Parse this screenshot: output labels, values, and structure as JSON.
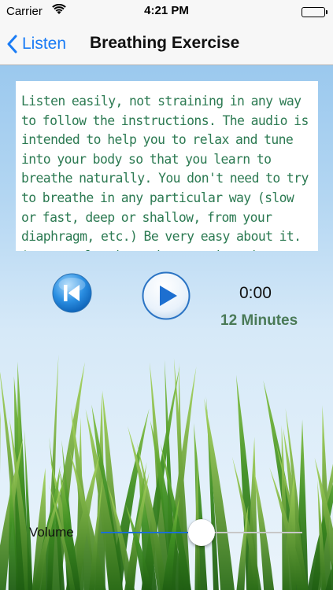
{
  "status_bar": {
    "carrier": "Carrier",
    "time": "4:21 PM"
  },
  "nav": {
    "back_label": "Listen",
    "title": "Breathing Exercise"
  },
  "instructions": {
    "text": "Listen easily, not straining in any way to follow the instructions. The audio is intended to help you to relax and tune into your body so that you learn to breathe naturally. You don't need to try to breathe in any particular way (slow or fast, deep or shallow, from your diaphragm, etc.) Be very easy about it. As you relax into the exercise, it"
  },
  "player": {
    "elapsed": "0:00",
    "duration": "12 Minutes",
    "rewind_icon": "rewind-icon",
    "play_icon": "play-icon"
  },
  "volume": {
    "label": "Volume",
    "level": 0.5
  },
  "colors": {
    "accent": "#1a7cf5",
    "text_green": "#2c7a52",
    "duration_green": "#4a7a57",
    "slider_fill": "#1c6fd6"
  }
}
